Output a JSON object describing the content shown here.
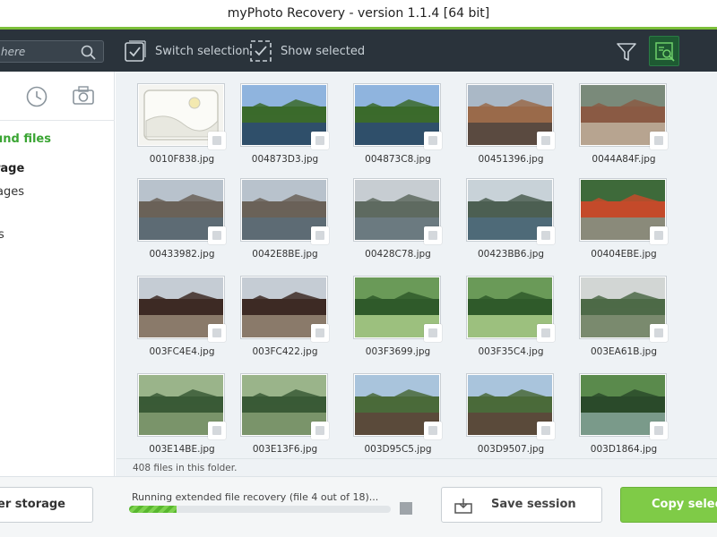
{
  "app": {
    "title": "myPhoto Recovery - version 1.1.4 [64 bit]"
  },
  "toolbar": {
    "search_placeholder": "here",
    "switch_selection_label": "Switch selection",
    "show_selected_label": "Show selected",
    "filter_icon": "filter-icon",
    "view_icon": "image-search-icon"
  },
  "sidebar": {
    "found_files_label": "und files",
    "storage_label": "rage",
    "images_label": "ages",
    "extra_label": "s"
  },
  "files": [
    {
      "name": "0010F838.jpg"
    },
    {
      "name": "004873D3.jpg"
    },
    {
      "name": "004873C8.jpg"
    },
    {
      "name": "00451396.jpg"
    },
    {
      "name": "0044A84F.jpg"
    },
    {
      "name": "00433982.jpg"
    },
    {
      "name": "0042E8BE.jpg"
    },
    {
      "name": "00428C78.jpg"
    },
    {
      "name": "00423BB6.jpg"
    },
    {
      "name": "00404EBE.jpg"
    },
    {
      "name": "003FC4E4.jpg"
    },
    {
      "name": "003FC422.jpg"
    },
    {
      "name": "003F3699.jpg"
    },
    {
      "name": "003F35C4.jpg"
    },
    {
      "name": "003EA61B.jpg"
    },
    {
      "name": "003E14BE.jpg"
    },
    {
      "name": "003E13F6.jpg"
    },
    {
      "name": "003D95C5.jpg"
    },
    {
      "name": "003D9507.jpg"
    },
    {
      "name": "003D1864.jpg"
    }
  ],
  "status": {
    "files_in_folder": "408 files in this folder."
  },
  "bottom": {
    "other_storage_label": "her storage",
    "progress_text": "Running extended file recovery (file 4 out of 18)...",
    "progress_fraction": 0.18,
    "save_session_label": "Save session",
    "copy_label": "Copy select"
  },
  "colors": {
    "accent_green": "#7cbf3a",
    "toolbar_bg": "#2a333b",
    "found_files_green": "#3aa533",
    "copy_button": "#7fcb47"
  }
}
